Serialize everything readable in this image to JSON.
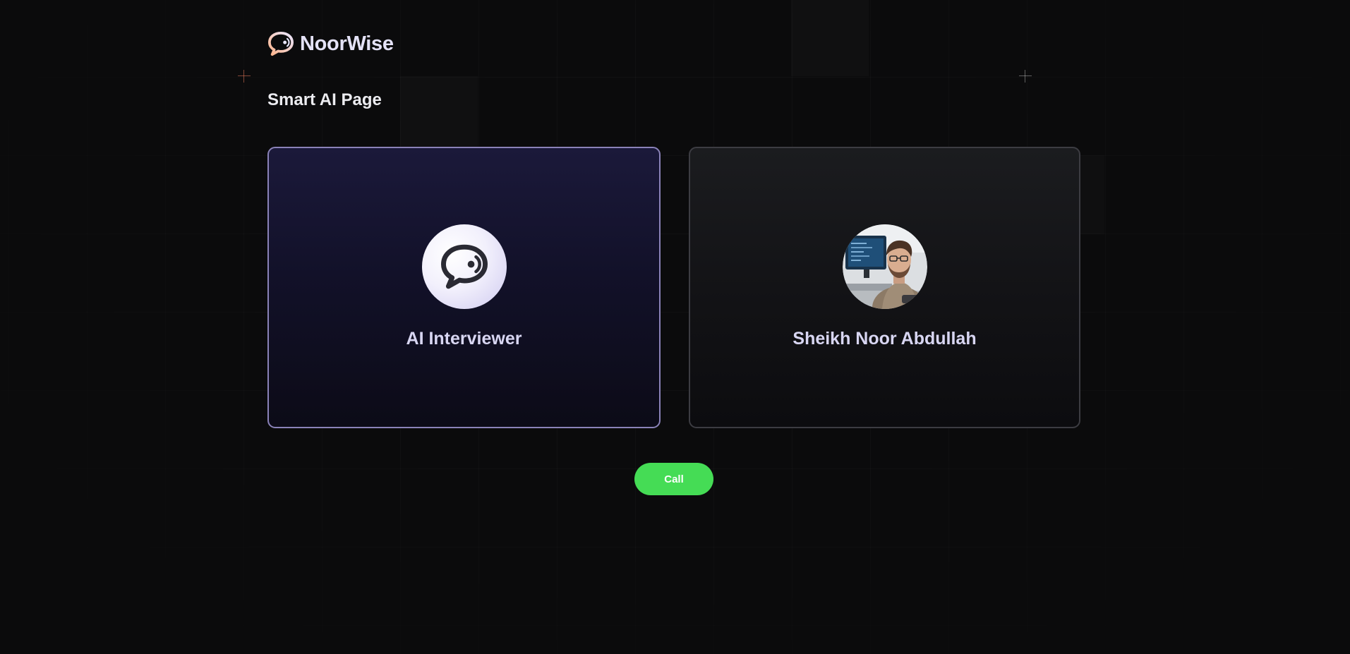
{
  "app": {
    "brand_name": "NoorWise",
    "logo_icon": "chat-voice-logo-icon"
  },
  "page": {
    "title": "Smart AI Page"
  },
  "participants": [
    {
      "name": "AI Interviewer",
      "avatar_icon": "chat-voice-icon",
      "selected": true
    },
    {
      "name": "Sheikh Noor Abdullah",
      "avatar_icon": "user-photo-avatar",
      "selected": false
    }
  ],
  "actions": {
    "call_label": "Call"
  },
  "colors": {
    "background": "#0b0b0c",
    "selected_card_border": "#8a82b8",
    "call_button": "#45dc55",
    "brand_gradient_start": "#ffb48a",
    "brand_gradient_end": "#e9e7ff"
  }
}
